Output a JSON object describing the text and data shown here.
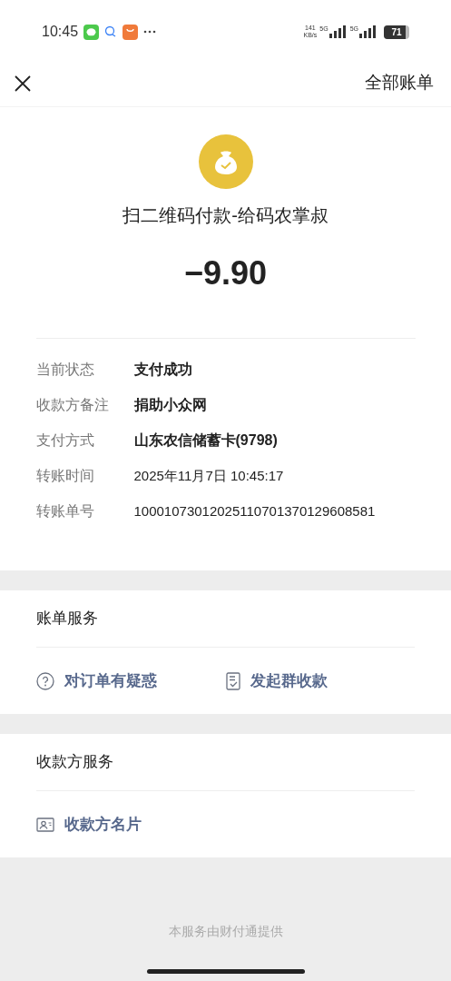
{
  "status_bar": {
    "time": "10:45",
    "speed_value": "141",
    "speed_unit": "KB/s",
    "network_labels": [
      "5G",
      "5G"
    ],
    "battery": "71"
  },
  "nav": {
    "right_link": "全部账单"
  },
  "summary": {
    "title": "扫二维码付款-给码农掌叔",
    "amount": "−9.90"
  },
  "details": [
    {
      "label": "当前状态",
      "value": "支付成功",
      "kind": "bold"
    },
    {
      "label": "收款方备注",
      "value": "捐助小众网",
      "kind": "bold"
    },
    {
      "label": "支付方式",
      "value": "山东农信储蓄卡(9798)",
      "kind": "bold"
    },
    {
      "label": "转账时间",
      "value": "2025年11月7日 10:45:17",
      "kind": "plain"
    },
    {
      "label": "转账单号",
      "value": "10001073012025110701370129608581",
      "kind": "plain"
    }
  ],
  "sections": [
    {
      "title": "账单服务",
      "actions": [
        {
          "label": "对订单有疑惑",
          "kind": "question"
        },
        {
          "label": "发起群收款",
          "kind": "receipt"
        }
      ]
    },
    {
      "title": "收款方服务",
      "actions": [
        {
          "label": "收款方名片",
          "kind": "card"
        }
      ]
    }
  ],
  "footer": "本服务由财付通提供"
}
